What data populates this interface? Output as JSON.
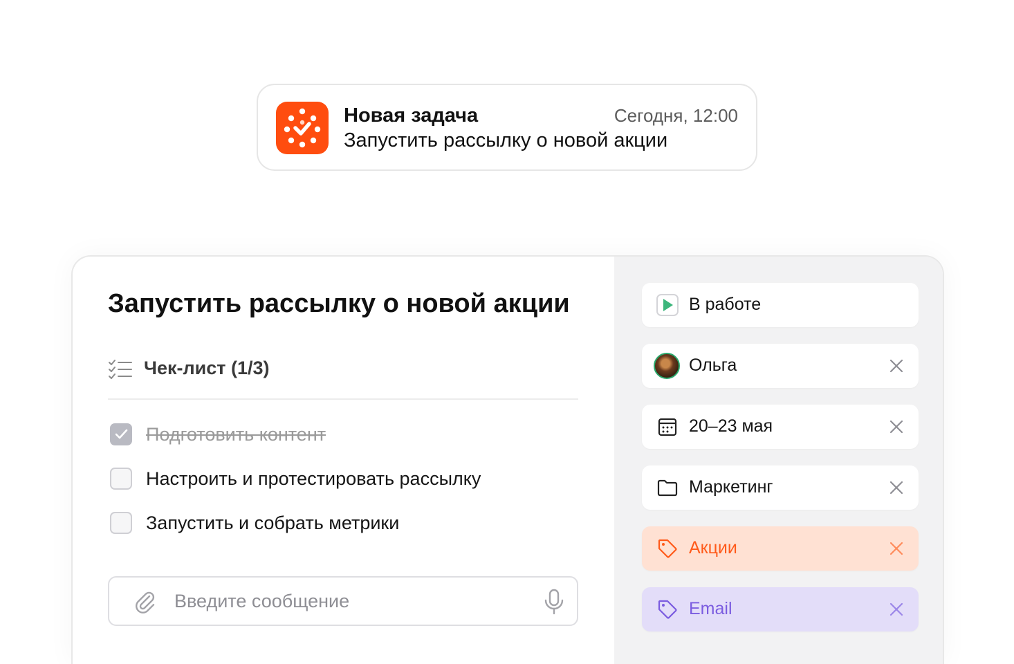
{
  "notification": {
    "title": "Новая задача",
    "time": "Сегодня, 12:00",
    "body": "Запустить рассылку о новой акции",
    "icon": "app-logo-icon",
    "accent": "#ff4d0f"
  },
  "task": {
    "title": "Запустить рассылку о новой акции",
    "checklist": {
      "label": "Чек-лист (1/3)",
      "items": [
        {
          "label": "Подготовить контент",
          "checked": true
        },
        {
          "label": "Настроить и протестировать рассылку",
          "checked": false
        },
        {
          "label": "Запустить и собрать метрики",
          "checked": false
        }
      ]
    },
    "message_input": {
      "placeholder": "Введите сообщение",
      "value": ""
    }
  },
  "properties": {
    "status": {
      "label": "В работе",
      "icon": "play-status-icon",
      "color": "#3db67c"
    },
    "assignee": {
      "label": "Ольга",
      "icon": "avatar"
    },
    "dates": {
      "label": "20–23 мая",
      "icon": "calendar-icon"
    },
    "project": {
      "label": "Маркетинг",
      "icon": "folder-icon"
    },
    "tags": [
      {
        "label": "Акции",
        "icon": "tag-icon",
        "color": "#ff5a1a",
        "background": "#ffe1d3"
      },
      {
        "label": "Email",
        "icon": "tag-icon",
        "color": "#7b5ce0",
        "background": "#e3ddf9"
      }
    ]
  }
}
